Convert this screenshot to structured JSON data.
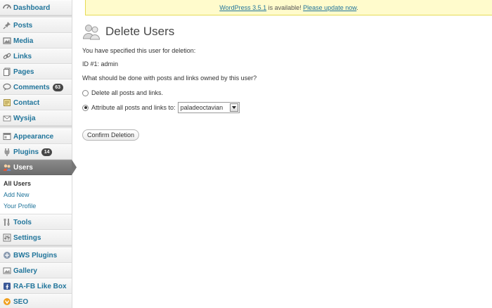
{
  "sidebar": {
    "dashboard": "Dashboard",
    "posts": "Posts",
    "media": "Media",
    "links": "Links",
    "pages": "Pages",
    "comments": "Comments",
    "comments_count": "63",
    "contact": "Contact",
    "wysija": "Wysija",
    "appearance": "Appearance",
    "plugins": "Plugins",
    "plugins_count": "14",
    "users": "Users",
    "users_sub": [
      "All Users",
      "Add New",
      "Your Profile"
    ],
    "tools": "Tools",
    "settings": "Settings",
    "bws_plugins": "BWS Plugins",
    "gallery": "Gallery",
    "rafb": "RA-FB Like Box",
    "seo": "SEO"
  },
  "notice": {
    "version_link": "WordPress 3.5.1",
    "middle": " is available! ",
    "update_link": "Please update now",
    "end": "."
  },
  "main": {
    "title": "Delete Users",
    "specified": "You have specified this user for deletion:",
    "user_id": "ID #1: admin",
    "question": "What should be done with posts and links owned by this user?",
    "option_delete": "Delete all posts and links.",
    "option_attribute": "Attribute all posts and links to:",
    "attribute_user": "paladeoctavian",
    "confirm_button": "Confirm Deletion"
  },
  "colors": {
    "link": "#21759b",
    "current_menu": "#767676",
    "notice_bg": "#fffbcc"
  }
}
